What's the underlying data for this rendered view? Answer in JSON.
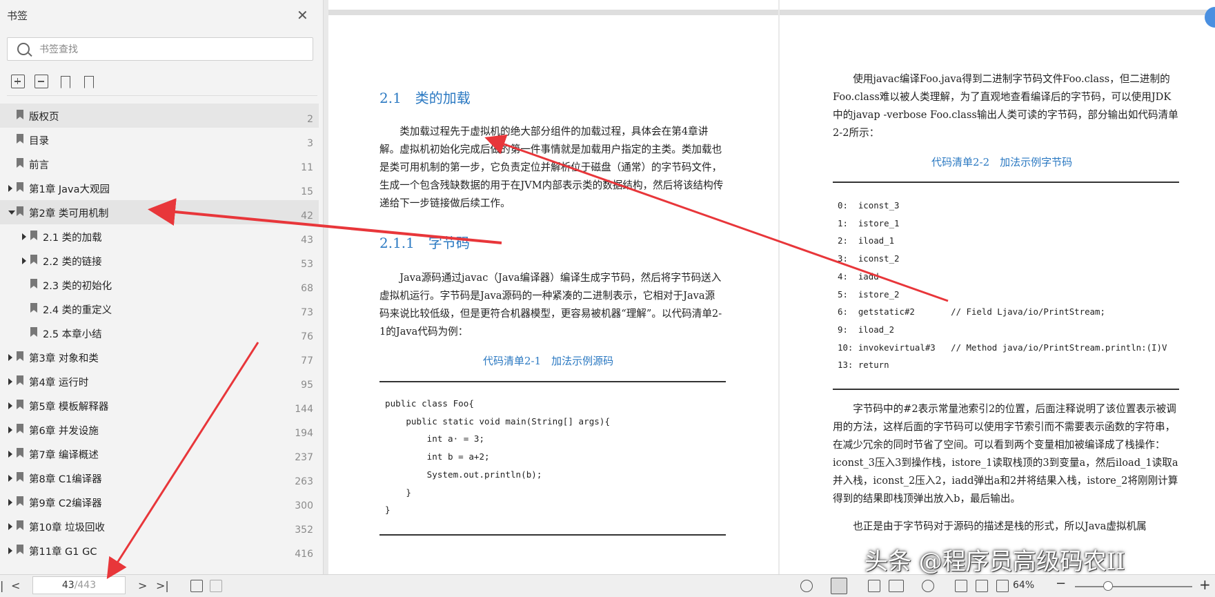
{
  "sidebar": {
    "title": "书签",
    "close_icon": "close-icon",
    "search_placeholder": "书签查找",
    "items": [
      {
        "label": "版权页",
        "page": "2",
        "level": 0,
        "expander": "none",
        "highlight": true
      },
      {
        "label": "目录",
        "page": "3",
        "level": 0,
        "expander": "none"
      },
      {
        "label": "前言",
        "page": "11",
        "level": 0,
        "expander": "none"
      },
      {
        "label": "第1章 Java大观园",
        "page": "15",
        "level": 0,
        "expander": "right"
      },
      {
        "label": "第2章 类可用机制",
        "page": "42",
        "level": 0,
        "expander": "down",
        "selected": true
      },
      {
        "label": "2.1 类的加载",
        "page": "43",
        "level": 1,
        "expander": "right"
      },
      {
        "label": "2.2 类的链接",
        "page": "53",
        "level": 1,
        "expander": "right"
      },
      {
        "label": "2.3 类的初始化",
        "page": "68",
        "level": 1,
        "expander": "none"
      },
      {
        "label": "2.4 类的重定义",
        "page": "73",
        "level": 1,
        "expander": "none"
      },
      {
        "label": "2.5 本章小结",
        "page": "76",
        "level": 1,
        "expander": "none"
      },
      {
        "label": "第3章 对象和类",
        "page": "77",
        "level": 0,
        "expander": "right"
      },
      {
        "label": "第4章 运行时",
        "page": "95",
        "level": 0,
        "expander": "right"
      },
      {
        "label": "第5章 模板解释器",
        "page": "144",
        "level": 0,
        "expander": "right"
      },
      {
        "label": "第6章 并发设施",
        "page": "194",
        "level": 0,
        "expander": "right"
      },
      {
        "label": "第7章 编译概述",
        "page": "237",
        "level": 0,
        "expander": "right"
      },
      {
        "label": "第8章 C1编译器",
        "page": "263",
        "level": 0,
        "expander": "right"
      },
      {
        "label": "第9章 C2编译器",
        "page": "300",
        "level": 0,
        "expander": "right"
      },
      {
        "label": "第10章 垃圾回收",
        "page": "352",
        "level": 0,
        "expander": "right"
      },
      {
        "label": "第11章 G1 GC",
        "page": "416",
        "level": 0,
        "expander": "right"
      }
    ]
  },
  "pager": {
    "current": "43",
    "total": "/443"
  },
  "zoom": {
    "level": "64%",
    "slider_fraction": 0.28
  },
  "left_page": {
    "h_section": "2.1　类的加载",
    "p1": "类加载过程先于虚拟机的绝大部分组件的加载过程，具体会在第4章讲解。虚拟机初始化完成后做的第一件事情就是加载用户指定的主类。类加载也是类可用机制的第一步，它负责定位并解析位于磁盘（通常）的字节码文件，生成一个包含残缺数据的用于在JVM内部表示类的数据结构，然后将该结构传递给下一步链接做后续工作。",
    "h_sub": "2.1.1　字节码",
    "p2": "Java源码通过javac（Java编译器）编译生成字节码，然后将字节码送入虚拟机运行。字节码是Java源码的一种紧凑的二进制表示，它相对于Java源码来说比较低级，但是更符合机器模型，更容易被机器“理解”。以代码清单2-1的Java代码为例：",
    "listing_caption": "代码清单2-1　加法示例源码",
    "code": [
      "public class Foo{",
      "    public static void main(String[] args){",
      "        int a· = 3;",
      "        int b = a+2;",
      "        System.out.println(b);",
      "    }",
      "}"
    ]
  },
  "right_page": {
    "p1": "使用javac编译Foo.java得到二进制字节码文件Foo.class，但二进制的Foo.class难以被人类理解，为了直观地查看编译后的字节码，可以使用JDK中的javap -verbose Foo.class输出人类可读的字节码，部分输出如代码清单2-2所示：",
    "listing_caption": "代码清单2-2　加法示例字节码",
    "bytecode": [
      "0:  iconst_3",
      "1:  istore_1",
      "2:  iload_1",
      "3:  iconst_2",
      "4:  iadd",
      "5:  istore_2",
      "6:  getstatic#2       // Field Ljava/io/PrintStream;",
      "9:  iload_2",
      "10: invokevirtual#3   // Method java/io/PrintStream.println:(I)V",
      "13: return"
    ],
    "p2": "字节码中的#2表示常量池索引2的位置，后面注释说明了该位置表示被调用的方法，这样后面的字节码可以使用字节索引而不需要表示函数的字符串，在减少冗余的同时节省了空间。可以看到两个变量相加被编译成了栈操作：iconst_3压入3到操作栈，istore_1读取栈顶的3到变量a，然后iload_1读取a并入栈，iconst_2压入2，iadd弹出a和2并将结果入栈，istore_2将刚刚计算得到的结果即栈顶弹出放入b，最后输出。",
    "p3": "也正是由于字节码对于源码的描述是栈的形式，所以Java虚拟机属"
  },
  "watermark": "头条 @程序员高级码农II",
  "colors": {
    "heading": "#2b79c2",
    "arrow": "#e8363a",
    "sidebar_bg": "#f3f3f3"
  }
}
